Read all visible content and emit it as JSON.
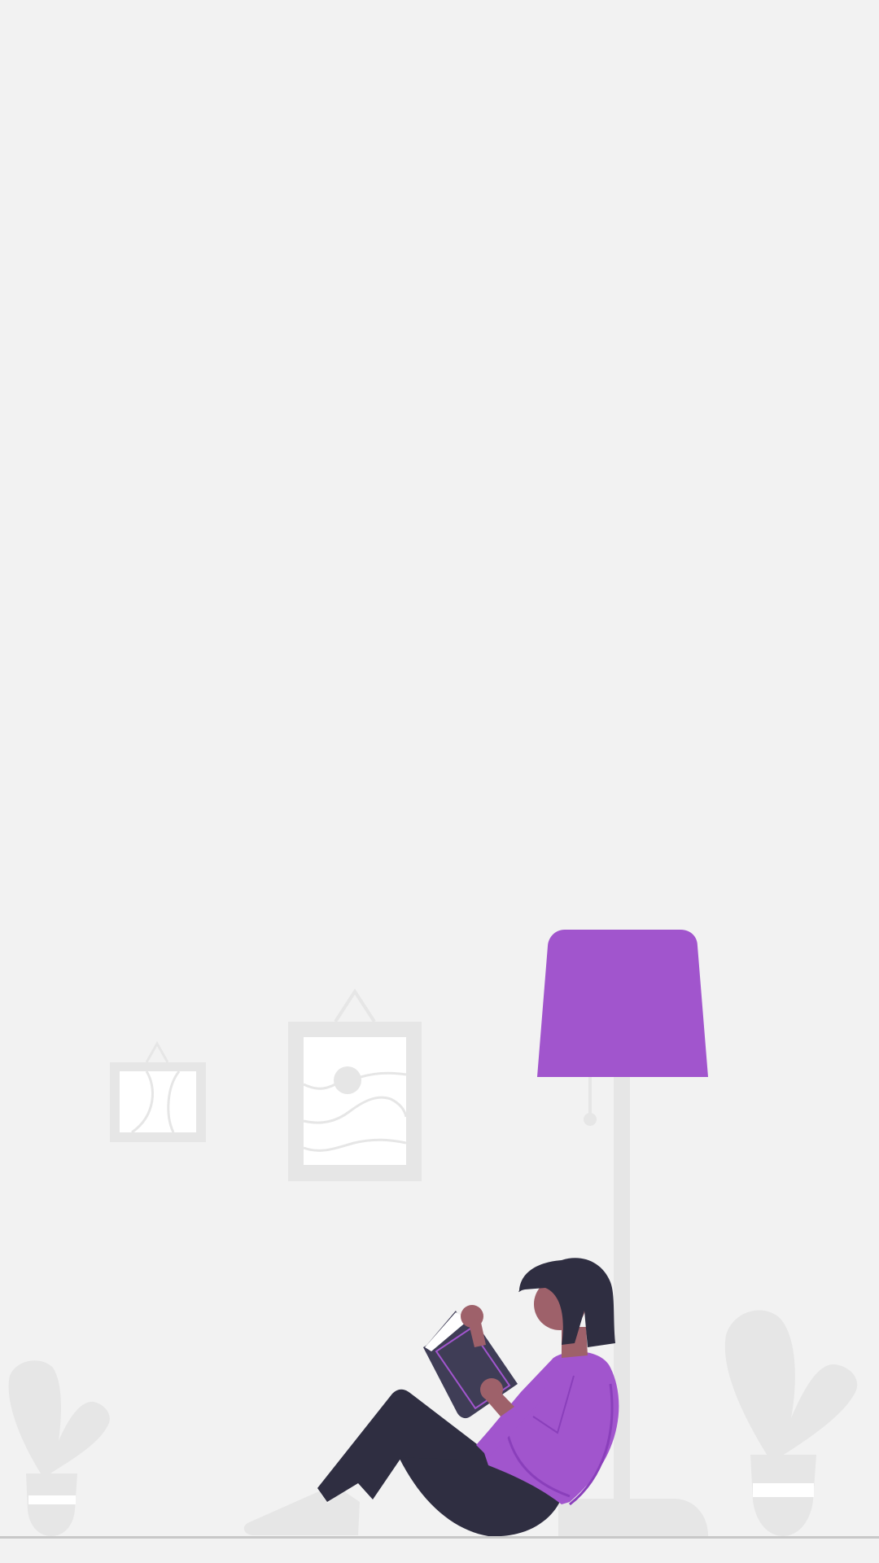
{
  "scene": {
    "description_free": true,
    "colors": {
      "background": "#f2f2f2",
      "accent": "#a155cd",
      "accent_dark": "#8a3fbb",
      "furniture": "#e6e6e6",
      "frame_inner": "#ffffff",
      "hair": "#2f2e41",
      "skin": "#9e616a",
      "book": "#3f3d56"
    },
    "icons": [
      "small-picture-frame-icon",
      "large-picture-frame-icon",
      "floor-lamp-icon",
      "reading-person-icon",
      "left-potted-plant-icon",
      "right-potted-plant-icon"
    ]
  }
}
